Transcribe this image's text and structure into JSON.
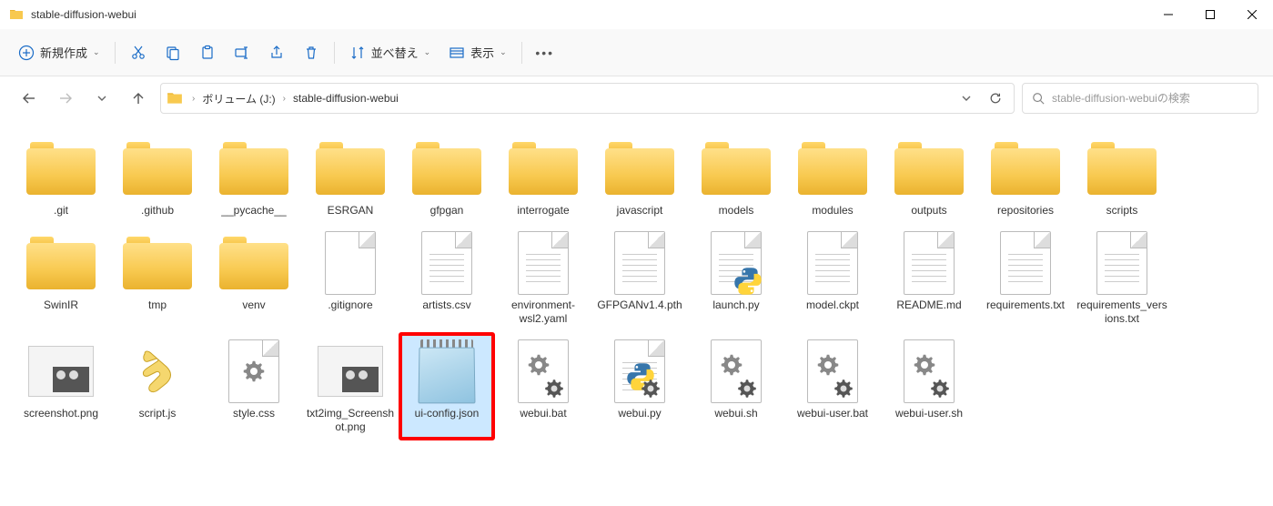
{
  "window": {
    "title": "stable-diffusion-webui"
  },
  "toolbar": {
    "new": "新規作成",
    "sort": "並べ替え",
    "view": "表示"
  },
  "breadcrumbs": [
    "ボリューム (J:)",
    "stable-diffusion-webui"
  ],
  "search": {
    "placeholder": "stable-diffusion-webuiの検索"
  },
  "items": [
    {
      "name": ".git",
      "type": "folder"
    },
    {
      "name": ".github",
      "type": "folder"
    },
    {
      "name": "__pycache__",
      "type": "folder"
    },
    {
      "name": "ESRGAN",
      "type": "folder"
    },
    {
      "name": "gfpgan",
      "type": "folder"
    },
    {
      "name": "interrogate",
      "type": "folder"
    },
    {
      "name": "javascript",
      "type": "folder"
    },
    {
      "name": "models",
      "type": "folder"
    },
    {
      "name": "modules",
      "type": "folder"
    },
    {
      "name": "outputs",
      "type": "folder"
    },
    {
      "name": "repositories",
      "type": "folder"
    },
    {
      "name": "scripts",
      "type": "folder"
    },
    {
      "name": "SwinIR",
      "type": "folder"
    },
    {
      "name": "tmp",
      "type": "folder"
    },
    {
      "name": "venv",
      "type": "folder"
    },
    {
      "name": ".gitignore",
      "type": "file"
    },
    {
      "name": "artists.csv",
      "type": "file-lines"
    },
    {
      "name": "environment-wsl2.yaml",
      "type": "file-lines"
    },
    {
      "name": "GFPGANv1.4.pth",
      "type": "file-lines"
    },
    {
      "name": "launch.py",
      "type": "python"
    },
    {
      "name": "model.ckpt",
      "type": "file-lines"
    },
    {
      "name": "README.md",
      "type": "file-lines"
    },
    {
      "name": "requirements.txt",
      "type": "file-lines"
    },
    {
      "name": "requirements_versions.txt",
      "type": "file-lines"
    },
    {
      "name": "screenshot.png",
      "type": "image"
    },
    {
      "name": "script.js",
      "type": "js"
    },
    {
      "name": "style.css",
      "type": "gear"
    },
    {
      "name": "txt2img_Screenshot.png",
      "type": "image"
    },
    {
      "name": "ui-config.json",
      "type": "notepad",
      "selected": true,
      "highlight": true
    },
    {
      "name": "webui.bat",
      "type": "gear2"
    },
    {
      "name": "webui.py",
      "type": "python-file"
    },
    {
      "name": "webui.sh",
      "type": "gear2"
    },
    {
      "name": "webui-user.bat",
      "type": "gear2"
    },
    {
      "name": "webui-user.sh",
      "type": "gear2"
    }
  ]
}
